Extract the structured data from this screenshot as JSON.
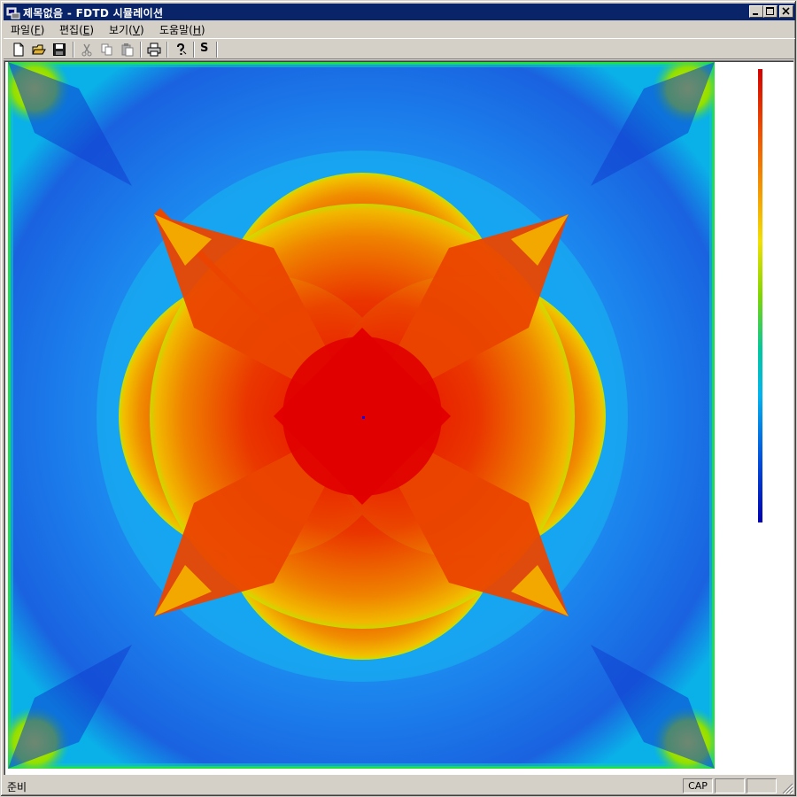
{
  "window": {
    "title": "제목없음 - FDTD 시뮬레이션",
    "controls": {
      "minimize_icon": "minimize-icon",
      "maximize_icon": "maximize-icon",
      "close_icon": "close-icon"
    },
    "titlebar_color": "#0a246a"
  },
  "menubar": {
    "items": [
      {
        "label": "파일(",
        "key": "F",
        "suffix": ")"
      },
      {
        "label": "편집(",
        "key": "E",
        "suffix": ")"
      },
      {
        "label": "보기(",
        "key": "V",
        "suffix": ")"
      },
      {
        "label": "도움말(",
        "key": "H",
        "suffix": ")"
      }
    ]
  },
  "toolbar": {
    "buttons": [
      {
        "icon": "new-file-icon",
        "enabled": true
      },
      {
        "icon": "open-folder-icon",
        "enabled": true
      },
      {
        "icon": "save-icon",
        "enabled": true
      },
      {
        "icon": "cut-icon",
        "enabled": false
      },
      {
        "icon": "copy-icon",
        "enabled": false
      },
      {
        "icon": "paste-icon",
        "enabled": false
      },
      {
        "icon": "print-icon",
        "enabled": true
      },
      {
        "icon": "help-icon",
        "enabled": true
      }
    ],
    "s_label": "S"
  },
  "simulation": {
    "colormap": [
      "#0000b0",
      "#0050e0",
      "#00b4f0",
      "#00c8a0",
      "#7fd600",
      "#f2e000",
      "#f5a000",
      "#f05000",
      "#d40000"
    ],
    "source_color": "#0000ff"
  },
  "statusbar": {
    "text": "준비",
    "cap": "CAP"
  }
}
